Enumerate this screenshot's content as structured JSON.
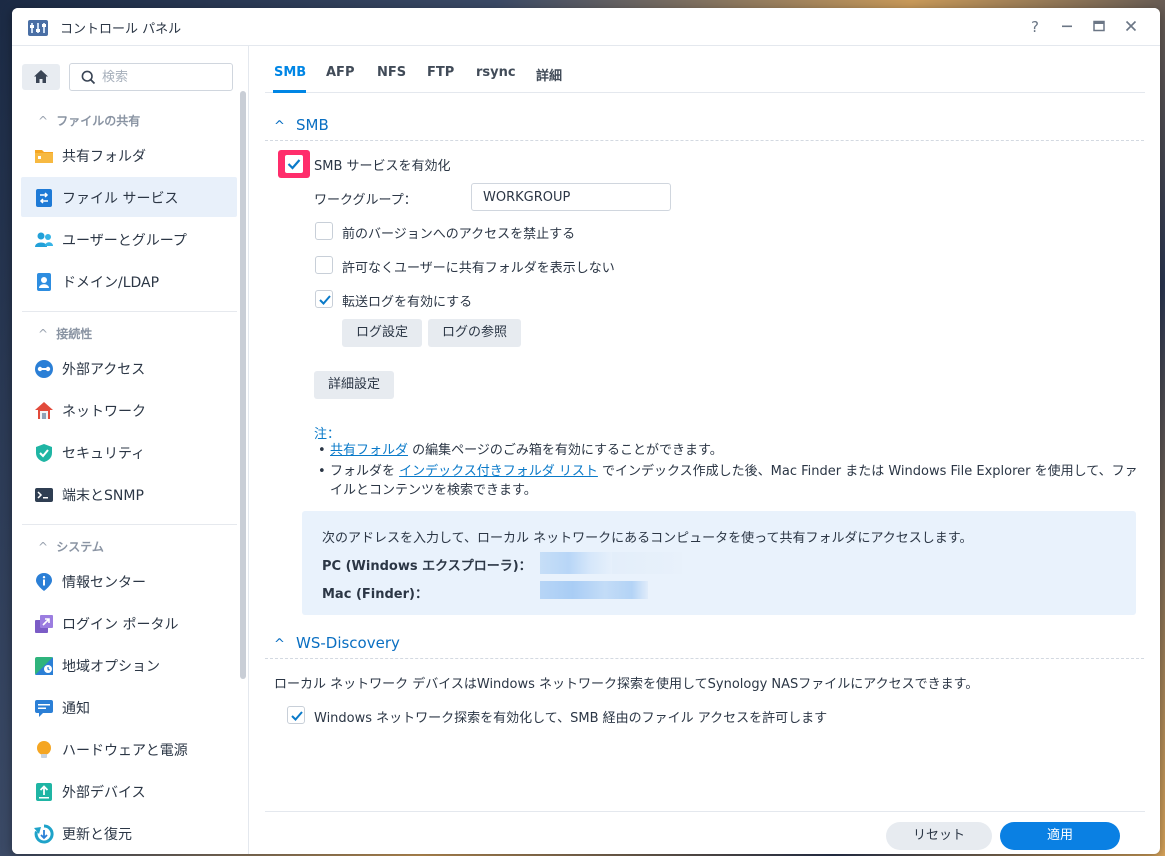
{
  "window": {
    "title": "コントロール パネル",
    "help_icon": "question-icon",
    "minimize_icon": "minimize-icon",
    "maximize_icon": "maximize-icon",
    "close_icon": "close-icon"
  },
  "sidebar": {
    "search_placeholder": "検索",
    "sections": [
      {
        "title": "ファイルの共有",
        "items": [
          {
            "label": "共有フォルダ",
            "icon": "folder-icon",
            "active": false
          },
          {
            "label": "ファイル サービス",
            "icon": "file-services-icon",
            "active": true
          },
          {
            "label": "ユーザーとグループ",
            "icon": "users-icon",
            "active": false
          },
          {
            "label": "ドメイン/LDAP",
            "icon": "domain-icon",
            "active": false
          }
        ]
      },
      {
        "title": "接続性",
        "items": [
          {
            "label": "外部アクセス",
            "icon": "external-access-icon",
            "active": false
          },
          {
            "label": "ネットワーク",
            "icon": "network-icon",
            "active": false
          },
          {
            "label": "セキュリティ",
            "icon": "shield-icon",
            "active": false
          },
          {
            "label": "端末とSNMP",
            "icon": "terminal-icon",
            "active": false
          }
        ]
      },
      {
        "title": "システム",
        "items": [
          {
            "label": "情報センター",
            "icon": "info-icon",
            "active": false
          },
          {
            "label": "ログイン ポータル",
            "icon": "login-portal-icon",
            "active": false
          },
          {
            "label": "地域オプション",
            "icon": "regional-icon",
            "active": false
          },
          {
            "label": "通知",
            "icon": "notification-icon",
            "active": false
          },
          {
            "label": "ハードウェアと電源",
            "icon": "bulb-icon",
            "active": false
          },
          {
            "label": "外部デバイス",
            "icon": "external-device-icon",
            "active": false
          },
          {
            "label": "更新と復元",
            "icon": "update-icon",
            "active": false
          }
        ]
      }
    ]
  },
  "tabs": [
    {
      "label": "SMB",
      "active": true
    },
    {
      "label": "AFP",
      "active": false
    },
    {
      "label": "NFS",
      "active": false
    },
    {
      "label": "FTP",
      "active": false
    },
    {
      "label": "rsync",
      "active": false
    },
    {
      "label": "詳細",
      "active": false
    }
  ],
  "smb": {
    "section_title": "SMB",
    "enable_label": "SMB サービスを有効化",
    "enable_checked": true,
    "workgroup_label": "ワークグループ：",
    "workgroup_value": "WORKGROUP",
    "opt1_label": "前のバージョンへのアクセスを禁止する",
    "opt1_checked": false,
    "opt2_label": "許可なくユーザーに共有フォルダを表示しない",
    "opt2_checked": false,
    "opt3_label": "転送ログを有効にする",
    "opt3_checked": true,
    "log_settings_button": "ログ設定",
    "log_view_button": "ログの参照",
    "advanced_button": "詳細設定"
  },
  "notes": {
    "head": "注：",
    "b1_link": "共有フォルダ",
    "b1_text": " の編集ページのごみ箱を有効にすることができます。",
    "b2_pre": "フォルダを ",
    "b2_link": "インデックス付きフォルダ リスト",
    "b2_text": " でインデックス作成した後、Mac Finder または Windows File Explorer を使用して、ファ",
    "b2_text2": "イルとコンテンツを検索できます。"
  },
  "info": {
    "line1": "次のアドレスを入力して、ローカル ネットワークにあるコンピュータを使って共有フォルダにアクセスします。",
    "pc_label": "PC (Windows エクスプローラ)：",
    "mac_label": "Mac (Finder)："
  },
  "wsd": {
    "section_title": "WS-Discovery",
    "desc": "ローカル ネットワーク デバイスはWindows ネットワーク探索を使用してSynology NASファイルにアクセスできます。",
    "enable_label": "Windows ネットワーク探索を有効化して、SMB 経由のファイル アクセスを許可します",
    "enable_checked": true
  },
  "footer": {
    "reset_button": "リセット",
    "apply_button": "適用"
  },
  "colors": {
    "accent": "#0086e5",
    "highlight": "#ff2d6b",
    "apply": "#0a80e3"
  }
}
